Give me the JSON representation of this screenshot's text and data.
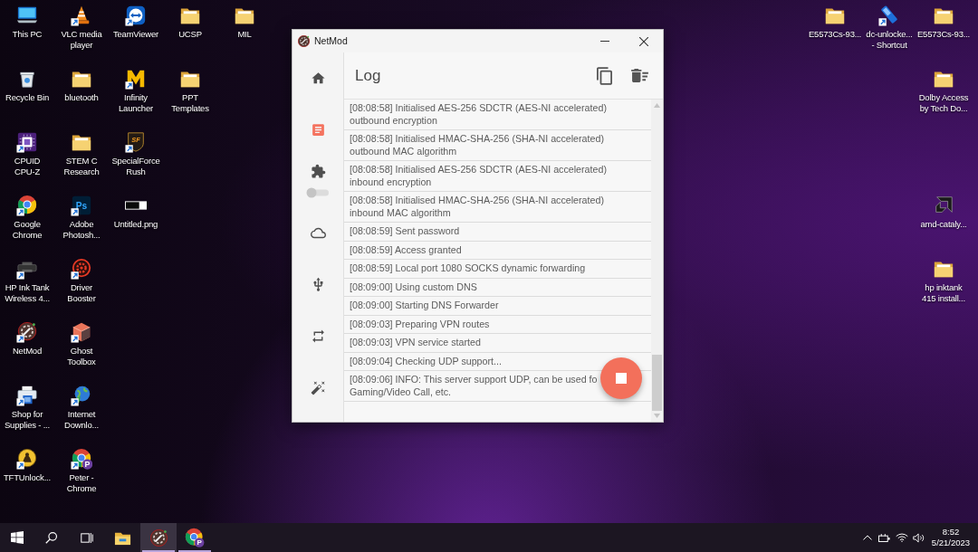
{
  "desktop": {
    "left_columns": [
      [
        {
          "label": "This PC"
        },
        {
          "label": "Recycle Bin"
        },
        {
          "label": "CPUID CPU-Z"
        },
        {
          "label": "Google Chrome"
        },
        {
          "label": "HP Ink Tank Wireless 4..."
        },
        {
          "label": "NetMod"
        },
        {
          "label": "Shop for Supplies - ..."
        },
        {
          "label": "TFTUnlock..."
        }
      ],
      [
        {
          "label": "VLC media player"
        },
        {
          "label": "bluetooth"
        },
        {
          "label": "STEM C Research"
        },
        {
          "label": "Adobe Photosh...",
          "logo_text": "Ps"
        },
        {
          "label": "Driver Booster"
        },
        {
          "label": "Ghost Toolbox"
        },
        {
          "label": "Internet Downlo..."
        },
        {
          "label": "Peter - Chrome",
          "logo_text": "P"
        }
      ],
      [
        {
          "label": "TeamViewer"
        },
        {
          "label": "Infinity Launcher"
        },
        {
          "label": "SpecialForce Rush",
          "logo_text": "SF"
        },
        {
          "label": "Untitled.png"
        }
      ],
      [
        {
          "label": "UCSP"
        },
        {
          "label": "PPT Templates"
        }
      ],
      [
        {
          "label": "MIL"
        }
      ]
    ],
    "right_columns": [
      [
        {
          "label": "E5573Cs-93..."
        }
      ],
      [
        {
          "label": "dc-unlocke... - Shortcut"
        }
      ],
      [
        {
          "label": "E5573Cs-93..."
        },
        {
          "label": "Dolby Access by Tech Do..."
        },
        {
          "label": "amd-cataly..."
        },
        {
          "label": "hp inktank 415 install..."
        }
      ]
    ]
  },
  "window": {
    "title": "NetMod",
    "sidebar": {
      "items": [
        {
          "selected": false
        },
        {
          "selected": true
        },
        {
          "selected": false
        },
        {
          "selected": false
        },
        {
          "selected": false
        },
        {
          "selected": false
        },
        {
          "selected": false
        }
      ],
      "toggle": {
        "on": false
      }
    },
    "page_title": "Log",
    "log": [
      {
        "text": "[08:08:58] Initialised AES-256 SDCTR (AES-NI accelerated) outbound encryption"
      },
      {
        "text": "[08:08:58] Initialised HMAC-SHA-256 (SHA-NI accelerated) outbound MAC algorithm"
      },
      {
        "text": "[08:08:58] Initialised AES-256 SDCTR (AES-NI accelerated) inbound encryption"
      },
      {
        "text": "[08:08:58] Initialised HMAC-SHA-256 (SHA-NI accelerated) inbound MAC algorithm"
      },
      {
        "text": "[08:08:59] Sent password"
      },
      {
        "text": "[08:08:59] Access granted"
      },
      {
        "text": "[08:08:59] Local port 1080 SOCKS dynamic forwarding"
      },
      {
        "text": "[08:09:00] Using custom DNS"
      },
      {
        "text": "[08:09:00] Starting DNS Forwarder"
      },
      {
        "text": "[08:09:03] Preparing VPN routes"
      },
      {
        "text": "[08:09:03] VPN service started"
      },
      {
        "text": "[08:09:04] Checking UDP support..."
      },
      {
        "text": "[08:09:06] INFO: This server support UDP, can be used fo Gaming/Video Call, etc."
      }
    ]
  },
  "taskbar": {
    "apps": [
      {
        "selected": false,
        "running": false
      },
      {
        "selected": true,
        "running": true
      },
      {
        "selected": false,
        "running": true,
        "badge_text": "P"
      }
    ],
    "clock": {
      "time": "8:52",
      "date": "5/21/2023"
    }
  }
}
